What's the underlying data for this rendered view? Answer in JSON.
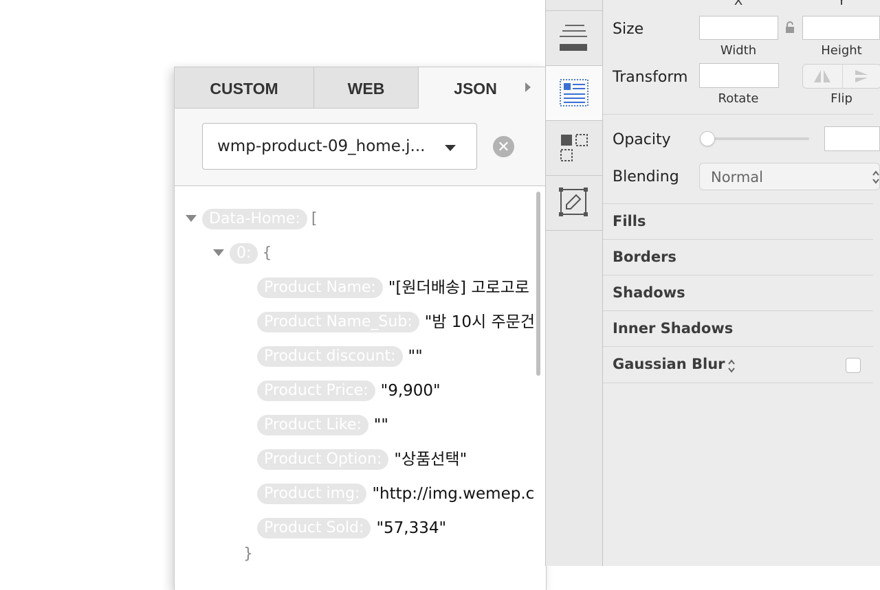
{
  "data_panel": {
    "tabs": [
      {
        "label": "CUSTOM",
        "active": false
      },
      {
        "label": "WEB",
        "active": false
      },
      {
        "label": "JSON",
        "active": true
      }
    ],
    "source_file": "wmp-product-09_home.j...",
    "tree": {
      "root_key": "Data-Home:",
      "root_bracket": "[",
      "item_key": "0:",
      "item_bracket": "{",
      "fields": [
        {
          "key": "Product Name:",
          "value": "\"[원더배송] 고로고로"
        },
        {
          "key": "Product Name_Sub:",
          "value": "\"밤 10시 주문건"
        },
        {
          "key": "Product discount:",
          "value": "\"\""
        },
        {
          "key": "Product Price:",
          "value": "\"9,900\""
        },
        {
          "key": "Product Like:",
          "value": "\"\""
        },
        {
          "key": "Product Option:",
          "value": "\"상품선택\""
        },
        {
          "key": "Product img:",
          "value": "\"http://img.wemep.c"
        },
        {
          "key": "Product Sold:",
          "value": "\"57,334\""
        }
      ],
      "item_close": "}"
    }
  },
  "toolbar": {
    "buttons": [
      {
        "icon": "align-bottom-icon",
        "active": false
      },
      {
        "icon": "text-layout-icon",
        "active": true
      },
      {
        "icon": "symbol-override-icon",
        "active": false
      },
      {
        "icon": "edit-artboard-icon",
        "active": false
      }
    ]
  },
  "inspector": {
    "x_label": "X",
    "y_label": "Y",
    "size_label": "Size",
    "width_label": "Width",
    "height_label": "Height",
    "transform_label": "Transform",
    "rotate_label": "Rotate",
    "flip_label": "Flip",
    "opacity_label": "Opacity",
    "opacity_value": 0,
    "blending_label": "Blending",
    "blending_value": "Normal",
    "sections": [
      "Fills",
      "Borders",
      "Shadows",
      "Inner Shadows",
      "Gaussian Blur"
    ]
  }
}
